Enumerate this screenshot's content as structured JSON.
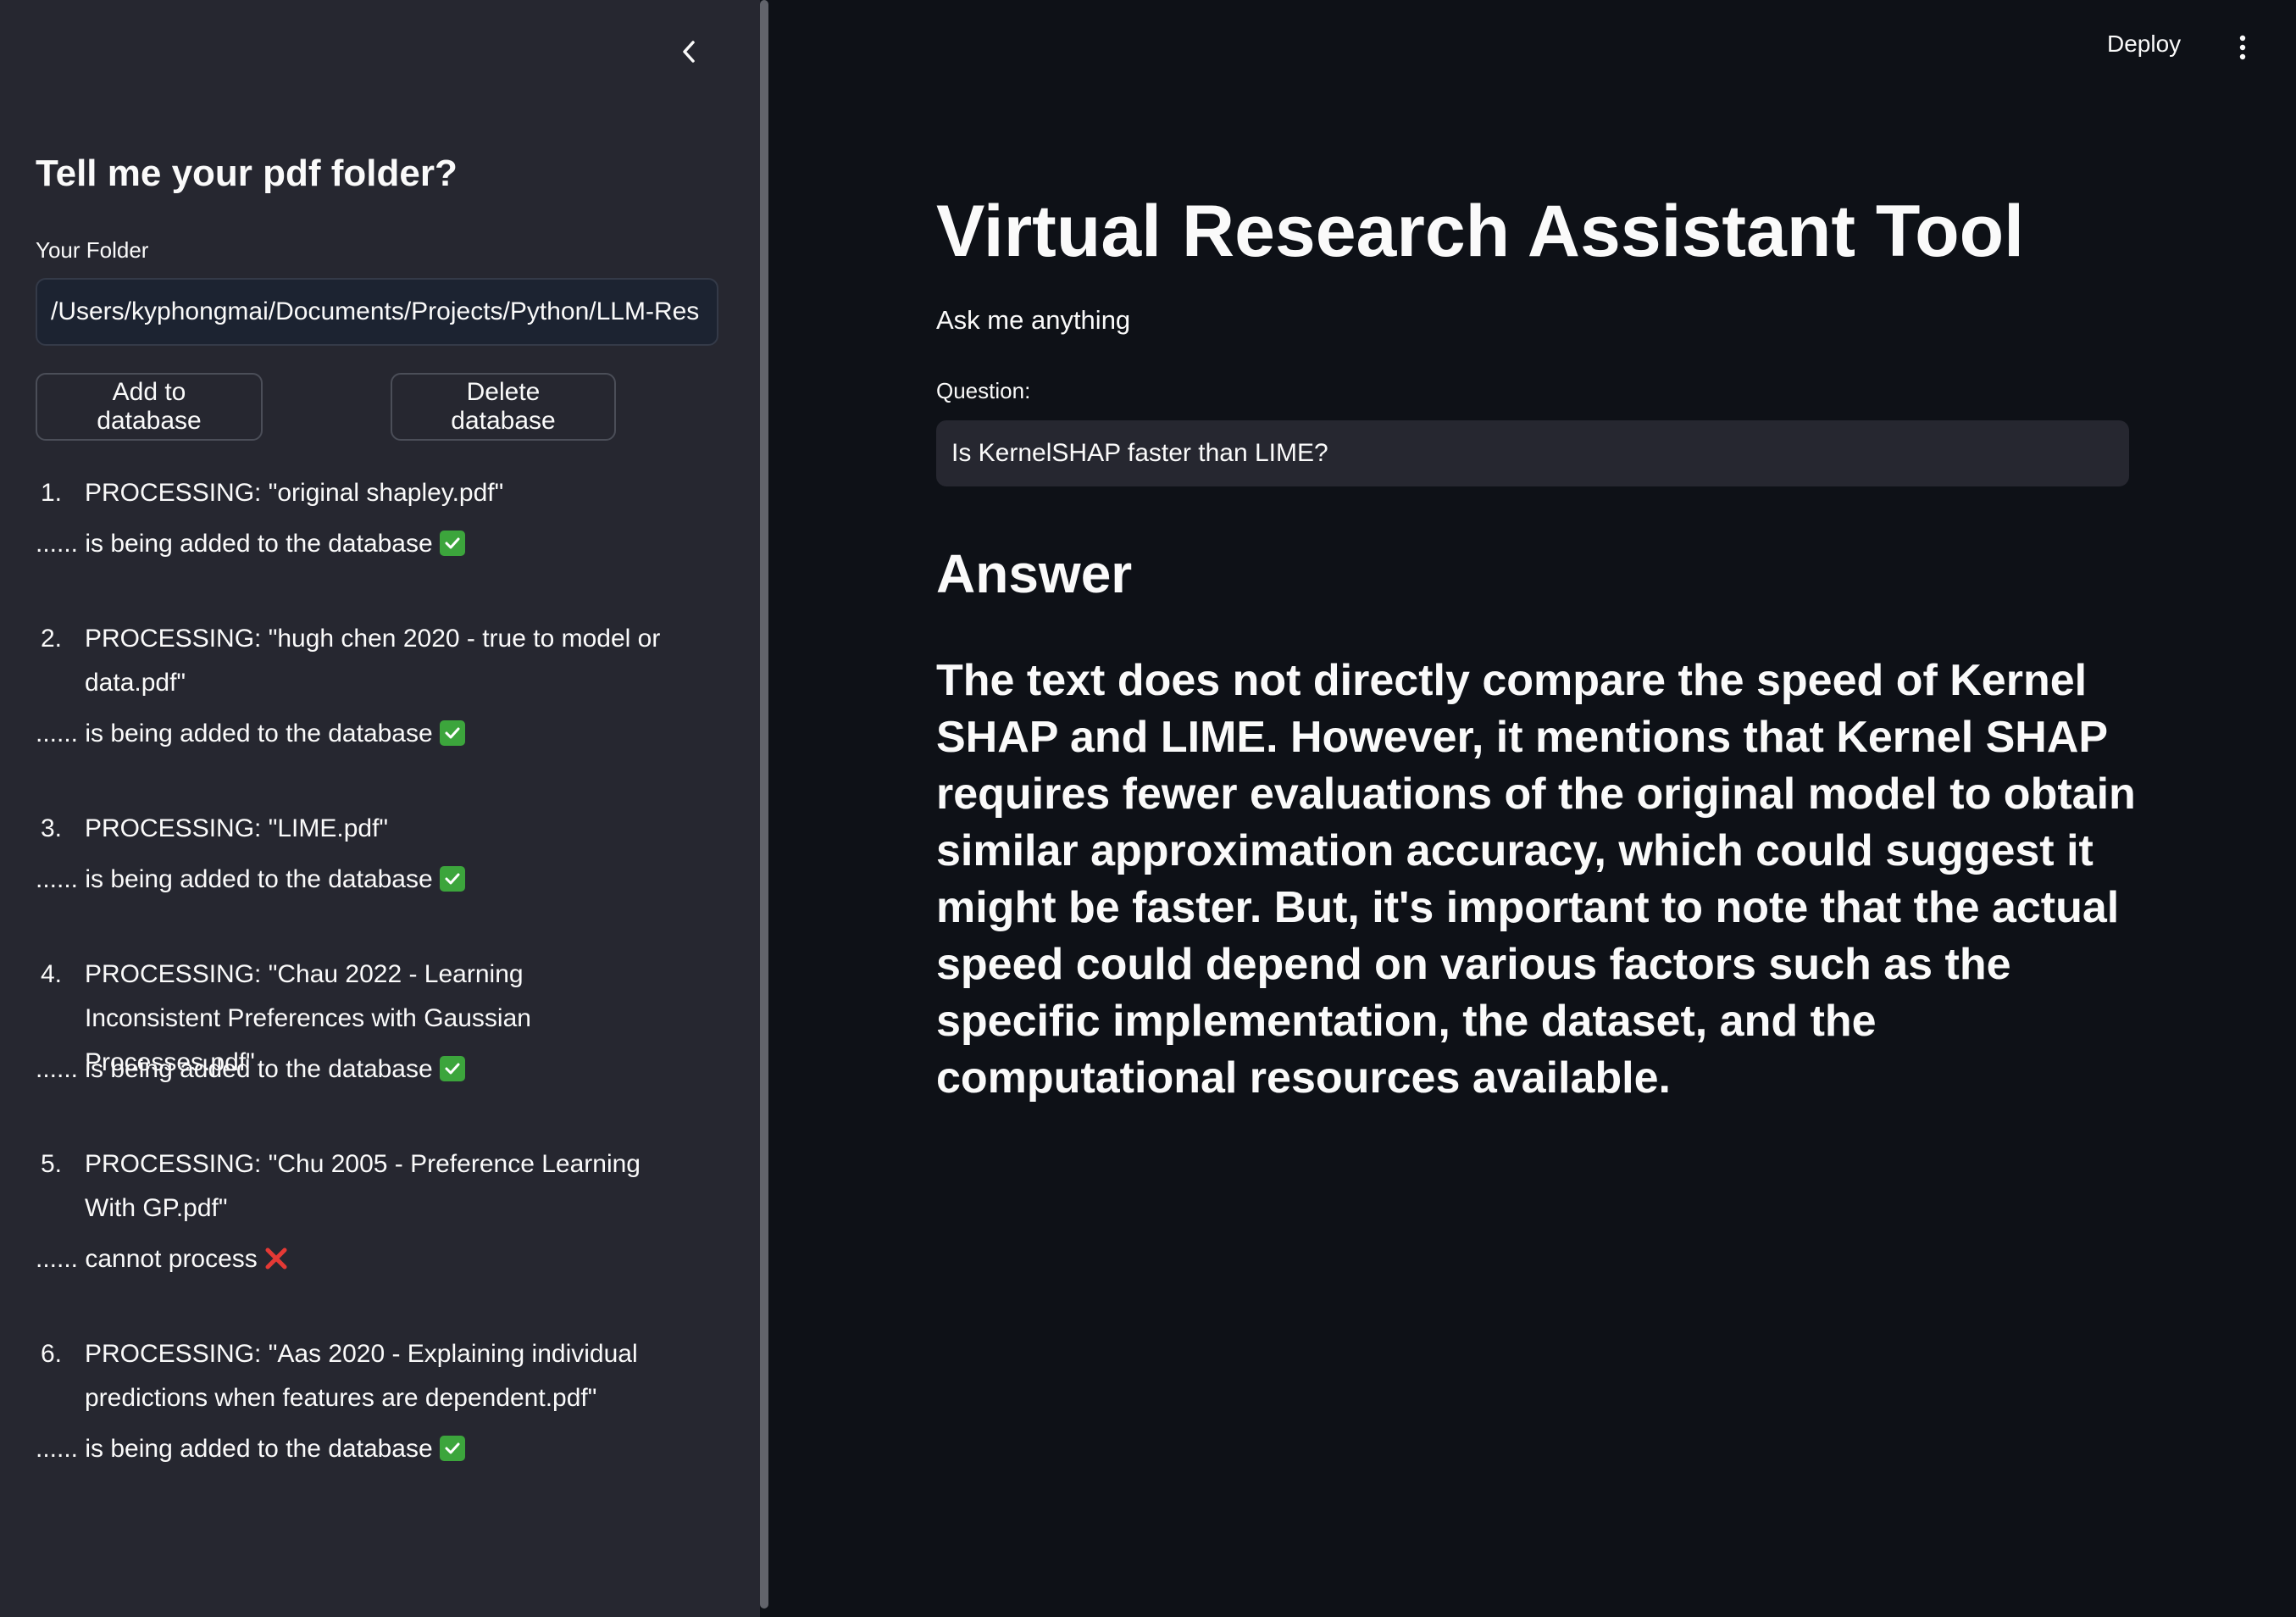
{
  "sidebar": {
    "header": "Tell me your pdf folder?",
    "folder_label": "Your Folder",
    "folder_value": "/Users/kyphongmai/Documents/Projects/Python/LLM-Res",
    "add_button": "Add to database",
    "delete_button": "Delete database",
    "log": [
      {
        "num": "1.",
        "processing": "PROCESSING: \"original shapley.pdf\"",
        "status": "...... is being added to the database",
        "status_icon": "check-icon"
      },
      {
        "num": "2.",
        "processing": "PROCESSING: \"hugh chen 2020 - true to model or data.pdf\"",
        "status": "...... is being added to the database",
        "status_icon": "check-icon"
      },
      {
        "num": "3.",
        "processing": "PROCESSING: \"LIME.pdf\"",
        "status": "...... is being added to the database",
        "status_icon": "check-icon"
      },
      {
        "num": "4.",
        "processing": "PROCESSING: \"Chau 2022 - Learning Inconsistent Preferences with Gaussian Processes.pdf\"",
        "status": "...... is being added to the database",
        "status_icon": "check-icon"
      },
      {
        "num": "5.",
        "processing": "PROCESSING: \"Chu 2005 - Preference Learning With GP.pdf\"",
        "status": "...... cannot process",
        "status_icon": "cross-icon"
      },
      {
        "num": "6.",
        "processing": "PROCESSING: \"Aas 2020 - Explaining individual predictions when features are dependent.pdf\"",
        "status": "...... is being added to the database",
        "status_icon": "check-icon"
      }
    ]
  },
  "header": {
    "deploy_label": "Deploy"
  },
  "main": {
    "title": "Virtual Research Assistant Tool",
    "subtitle": "Ask me anything",
    "question_label": "Question:",
    "question_value": "Is KernelSHAP faster than LIME?",
    "answer_heading": "Answer",
    "answer_text": "The text does not directly compare the speed of Kernel SHAP and LIME. However, it mentions that Kernel SHAP requires fewer evaluations of the original model to obtain similar approximation accuracy, which could suggest it might be faster. But, it's important to note that the actual speed could depend on various factors such as the specific implementation, the dataset, and the computational resources available."
  },
  "colors": {
    "sidebar_bg": "#262730",
    "main_bg": "#0e1117",
    "success": "#3ca53c",
    "error": "#e53935"
  }
}
